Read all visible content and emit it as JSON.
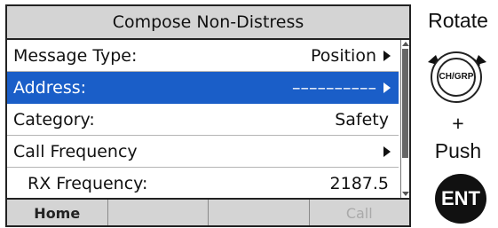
{
  "screen": {
    "title": "Compose Non-Distress",
    "rows": [
      {
        "label": "Message Type:",
        "value": "Position",
        "arrow": true
      },
      {
        "label": "Address:",
        "value": "––––––––––",
        "arrow": true,
        "selected": true
      },
      {
        "label": "Category:",
        "value": "Safety",
        "arrow": false
      },
      {
        "label": "Call Frequency",
        "value": "",
        "arrow": true
      },
      {
        "label": "RX Frequency:",
        "value": "2187.5",
        "arrow": false
      }
    ],
    "scroll_position": 0.0,
    "scroll_visible_fraction": 0.78,
    "softkeys": [
      {
        "label": "Home",
        "enabled": true
      },
      {
        "label": "",
        "enabled": true
      },
      {
        "label": "",
        "enabled": true
      },
      {
        "label": "Call",
        "enabled": false
      }
    ]
  },
  "hints": {
    "rotate": "Rotate",
    "dial_label": "CH/GRP",
    "plus": "+",
    "push": "Push",
    "ent_label": "ENT"
  },
  "colors": {
    "selection": "#1a5ec8",
    "bar_gray": "#d4d4d4"
  },
  "icons": {
    "row_arrow": "triangle-right-icon",
    "dial": "rotary-dial-icon",
    "rotate_arrows": "rotate-arrows-icon",
    "ent": "ent-key-icon"
  }
}
